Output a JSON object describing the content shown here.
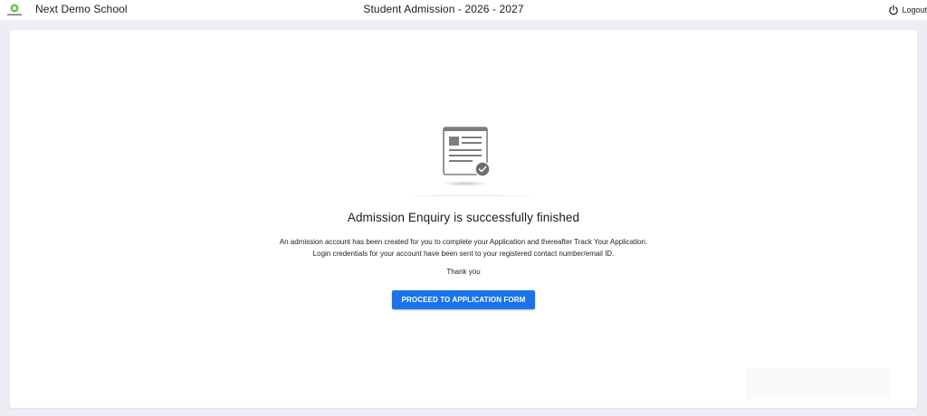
{
  "header": {
    "school_name": "Next Demo School",
    "title": "Student Admission - 2026 - 2027",
    "logout_label": "Logout",
    "logo_icon": "school-logo-icon",
    "logout_icon": "power-icon"
  },
  "main": {
    "illustration_icon": "document-check-icon",
    "heading": "Admission Enquiry is successfully finished",
    "message_line1": "An admission account has been created for you to complete your Application and thereafter Track Your Application.",
    "message_line2": "Login credentials for your account have been sent to your registered contact number/email ID.",
    "thanks": "Thank you",
    "proceed_button": "PROCEED TO APPLICATION FORM"
  },
  "colors": {
    "accent": "#1a73e8",
    "page_background": "#ecedf5",
    "card_background": "#ffffff",
    "logo_green": "#6cc04a"
  }
}
